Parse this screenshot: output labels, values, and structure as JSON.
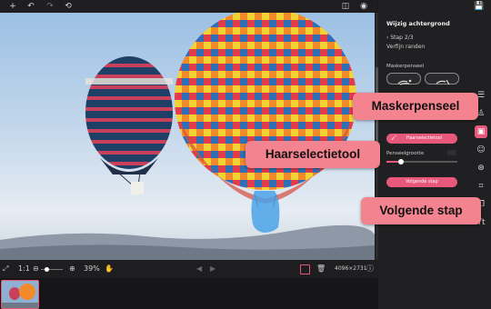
{
  "toolbar": {
    "icons": [
      "plus-icon",
      "undo-icon",
      "redo-icon",
      "reset-icon",
      "compare-icon",
      "preview-icon",
      "save-icon"
    ]
  },
  "bottombar": {
    "fit_label": "1:1",
    "zoom_value": "39%",
    "dimensions": "4096×2731"
  },
  "panel": {
    "title": "Wijzig achtergrond",
    "step": "Stap 2/3",
    "subtitle": "Verfijn randen",
    "mask_brush_label": "Maskerpenseel",
    "hair_tool_button": "Haarselectietool",
    "brush_size_label": "Penseelgrootte",
    "brush_size_value": 0.2,
    "next_button": "Volgende stap"
  },
  "callouts": {
    "mask_brush": "Maskerpenseel",
    "hair_tool": "Haarselectietool",
    "next_step": "Volgende stap"
  },
  "colors": {
    "accent": "#e8587a",
    "callout_bg": "#f3838f",
    "panel_bg": "#202022",
    "app_bg": "#1b1b1d"
  }
}
